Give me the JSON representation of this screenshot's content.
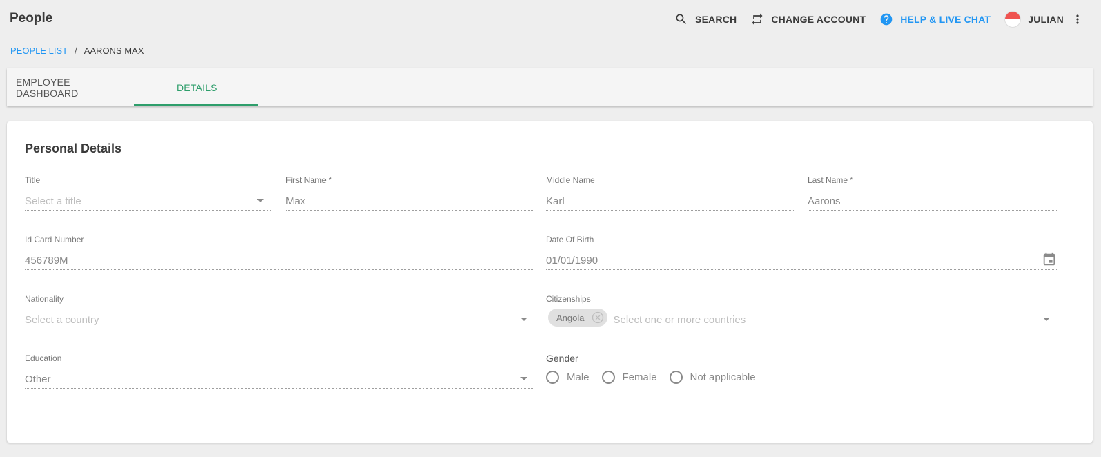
{
  "app": {
    "title": "People"
  },
  "topbar": {
    "search_label": "SEARCH",
    "change_account_label": "CHANGE ACCOUNT",
    "help_label": "HELP & LIVE CHAT",
    "user_label": "JULIAN"
  },
  "breadcrumb": {
    "parent": "PEOPLE LIST",
    "separator": "/",
    "current": "AARONS MAX"
  },
  "tabs": [
    {
      "label": "EMPLOYEE DASHBOARD",
      "active": false
    },
    {
      "label": "DETAILS",
      "active": true
    }
  ],
  "colors": {
    "accent_green": "#2e9e6b",
    "link_blue": "#2196f3"
  },
  "personal": {
    "section_title": "Personal Details",
    "title": {
      "label": "Title",
      "placeholder": "Select a title",
      "value": ""
    },
    "first_name": {
      "label": "First Name *",
      "value": "Max"
    },
    "middle_name": {
      "label": "Middle Name",
      "value": "Karl"
    },
    "last_name": {
      "label": "Last Name *",
      "value": "Aarons"
    },
    "id_card": {
      "label": "Id Card Number",
      "value": "456789M"
    },
    "dob": {
      "label": "Date Of Birth",
      "value": "01/01/1990",
      "icon": "calendar-icon"
    },
    "nationality": {
      "label": "Nationality",
      "placeholder": "Select a country",
      "value": ""
    },
    "citizenships": {
      "label": "Citizenships",
      "chips": [
        "Angola"
      ],
      "placeholder": "Select one or more countries"
    },
    "education": {
      "label": "Education",
      "value": "Other"
    },
    "gender": {
      "label": "Gender",
      "options": [
        "Male",
        "Female",
        "Not applicable"
      ],
      "selected": null
    }
  }
}
